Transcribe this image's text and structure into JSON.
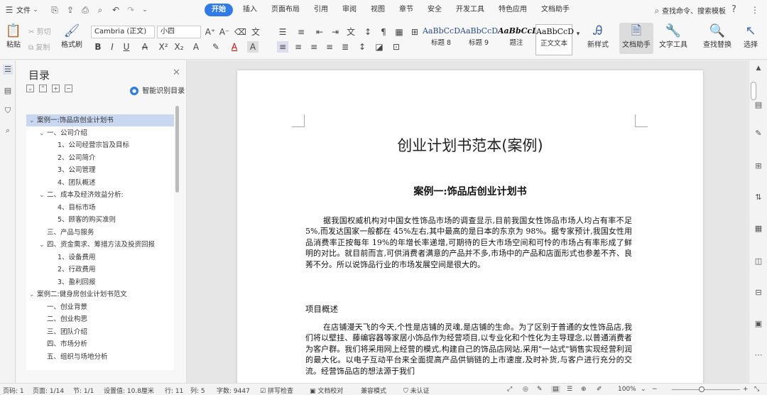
{
  "menu": {
    "file_label": "文件",
    "tabs": [
      "开始",
      "插入",
      "页面布局",
      "引用",
      "审阅",
      "视图",
      "章节",
      "安全",
      "开发工具",
      "特色应用",
      "文档助手"
    ],
    "active_tab": "开始",
    "search_label": "查找命令、搜索模板",
    "help": "?"
  },
  "ribbon": {
    "paste": "粘贴",
    "cut": "剪切",
    "copy": "复制",
    "format_painter": "格式刷",
    "font_name": "Cambria (正文)",
    "font_size": "小四",
    "styles": [
      {
        "sample": "AaBbCcD",
        "name": "标题 8"
      },
      {
        "sample": "AaBbCcD",
        "name": "标题 9"
      },
      {
        "sample": "AaBbCcD",
        "name": "题注"
      },
      {
        "sample": "AaBbCcD",
        "name": "正文文本"
      }
    ],
    "new_style": "新样式",
    "doc_assistant": "文档助手",
    "text_tools": "文字工具",
    "find_replace": "查找替换",
    "select": "选择"
  },
  "toc": {
    "title": "目录",
    "smart_label": "智能识别目录",
    "items": [
      "案例一:饰品店创业计划书",
      "一、公司介绍",
      "1、公司经营宗旨及目标",
      "2、公司简介",
      "3、公司管理",
      "4、团队概述",
      "二、成本及经济效益分析:",
      "4、目标市场",
      "5、顾客的购买准则",
      "三、产品与服务",
      "四、资金需求、筹措方法及投资回报",
      "1、设备费用",
      "2、行政费用",
      "3、盈利回报",
      "案例二:健身房创业计划书范文",
      "一、创业背景",
      "二、创业构思",
      "三、团队介绍",
      "四、市场分析",
      "五、组织与场地分析"
    ]
  },
  "document": {
    "title": "创业计划书范本(案例)",
    "heading": "案例一:饰品店创业计划书",
    "para1": "据我国权威机构对中国女性饰品市场的调查显示,目前我国女性饰品市场人均占有率不足 5%,而发达国家一般都在 45%左右,其中最高的是日本的东京为 98%。据专家预计,我国女性用品消费率正按每年 19%的年增长率递增,可期待的巨大市场空间和可怜的市场占有率形成了鲜明的对比。就目前而言,可供消费者满意的产品并不多,市场中的产品和店面形式也参差不齐、良莠不分。所以说饰品行业的市场发展空间是很大的。",
    "subheading": "项目概述",
    "para2": "在店铺漫天飞的今天,个性是店铺的灵魂,是店铺的生命。为了区别于普通的女性饰品店,我们将以壁挂、藤编容器等家居小饰品作为经营项目,以专业化和个性化为主导理念,以普通消费者为客户群。我们将采用网上经营的模式,构建自己的饰品店网站,采用\"一站式\"销售实现经营利润的最大化。以电子互动平台来全面提高产品供销链的上市速度,及时补货,与客户进行充分的交流。经营饰品店的想法源于我们"
  },
  "status": {
    "page_num": "页码: 1",
    "pages": "页面: 1/14",
    "section": "节: 1/1",
    "setting": "设置值: 10.8厘米",
    "row": "行: 11",
    "col": "列: 5",
    "words": "字数: 9447",
    "spell": "拼写检查",
    "proof": "文档校对",
    "compat": "兼容模式",
    "auth": "未认证",
    "zoom": "100%"
  }
}
